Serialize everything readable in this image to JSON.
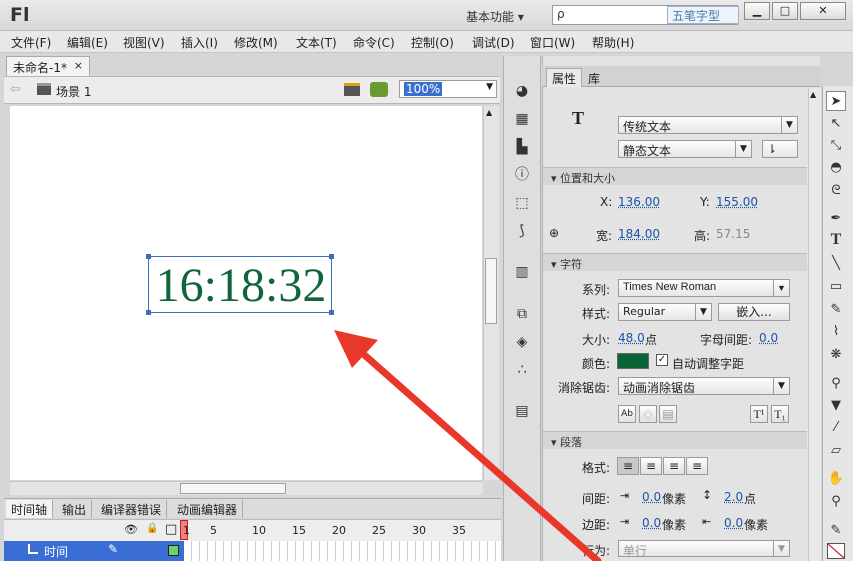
{
  "titlebar": {
    "logo": "Fl",
    "workspace": "基本功能 ▾",
    "search_icon": "ρ",
    "watermark": "五笔字型",
    "min": "▁",
    "max": "□",
    "close": "✕"
  },
  "menubar": {
    "items": [
      "文件(F)",
      "编辑(E)",
      "视图(V)",
      "插入(I)",
      "修改(M)",
      "文本(T)",
      "命令(C)",
      "控制(O)",
      "调试(D)",
      "窗口(W)",
      "帮助(H)"
    ]
  },
  "document": {
    "tab_label": "未命名-1*",
    "tab_close": "×",
    "back_arrow": "⇦",
    "scene_label": "场景 1",
    "zoom": "100%"
  },
  "stage": {
    "clock_text": "16:18:32",
    "clock_color": "#10653c"
  },
  "timeline": {
    "tabs": [
      "时间轴",
      "输出",
      "编译器错误",
      "动画编辑器"
    ],
    "frame_numbers": [
      "1",
      "5",
      "10",
      "15",
      "20",
      "25",
      "30",
      "35"
    ],
    "layer_name": "时间",
    "header_icons": {
      "eye": "👁",
      "lock": "🔒",
      "outline": "□"
    }
  },
  "properties": {
    "tabs": [
      "属性",
      "库"
    ],
    "type_icon": "T",
    "text_engine": "传统文本",
    "text_type": "静态文本",
    "position": {
      "section": "位置和大小",
      "x_label": "X:",
      "x": "136.00",
      "y_label": "Y:",
      "y": "155.00",
      "w_label": "宽:",
      "w": "184.00",
      "h_label": "高:",
      "h": "57.15"
    },
    "character": {
      "section": "字符",
      "family_label": "系列:",
      "family": "Times New Roman",
      "style_label": "样式:",
      "style": "Regular",
      "embed": "嵌入...",
      "size_label": "大小:",
      "size": "48.0",
      "size_unit": "点",
      "spacing_label": "字母间距:",
      "spacing": "0.0",
      "color_label": "颜色:",
      "color": "#0b6435",
      "auto_kern": "自动调整字距",
      "anti_alias_label": "消除锯齿:",
      "anti_alias": "动画消除锯齿"
    },
    "paragraph": {
      "section": "段落",
      "format_label": "格式:",
      "spacing_label": "间距:",
      "indent": "0.0",
      "indent_unit": "像素",
      "line_spacing": "2.0",
      "line_unit": "点",
      "margin_label": "边距:",
      "left_margin": "0.0",
      "left_unit": "像素",
      "right_margin": "0.0",
      "right_unit": "像素",
      "behavior_label": "行为:",
      "behavior": "单行"
    }
  }
}
